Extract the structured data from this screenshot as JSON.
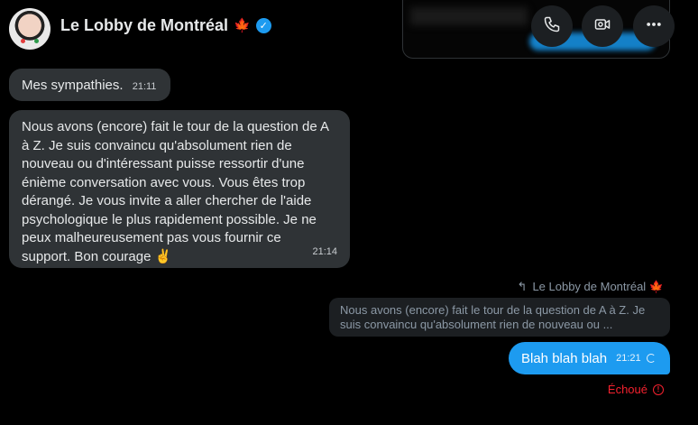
{
  "header": {
    "name": "Le Lobby de Montréal",
    "flag": "🍁",
    "verified": "✓",
    "accent_color": "#1d9bf0"
  },
  "messages": [
    {
      "text": "Mes sympathies.",
      "time": "21:11"
    },
    {
      "text": "Nous avons (encore) fait le tour de la question de A à Z. Je suis convaincu qu'absolument rien de nouveau ou d'intéressant puisse ressortir d'une énième conversation avec vous. Vous êtes trop dérangé. Je vous invite a aller chercher de l'aide psychologique le plus rapidement possible. Je ne peux malheureusement pas vous fournir ce support. Bon courage ✌️",
      "time": "21:14"
    }
  ],
  "reply": {
    "to": "Le Lobby de Montréal 🍁",
    "quote": "Nous avons (encore) fait le tour de la question de A à Z. Je suis convaincu qu'absolument rien de nouveau ou ..."
  },
  "outgoing": {
    "text": "Blah blah blah",
    "time": "21:21",
    "status": "Échoué"
  },
  "icons": [
    "phone-icon",
    "video-icon",
    "more-icon",
    "reply-icon",
    "spinner-icon",
    "error-icon"
  ]
}
